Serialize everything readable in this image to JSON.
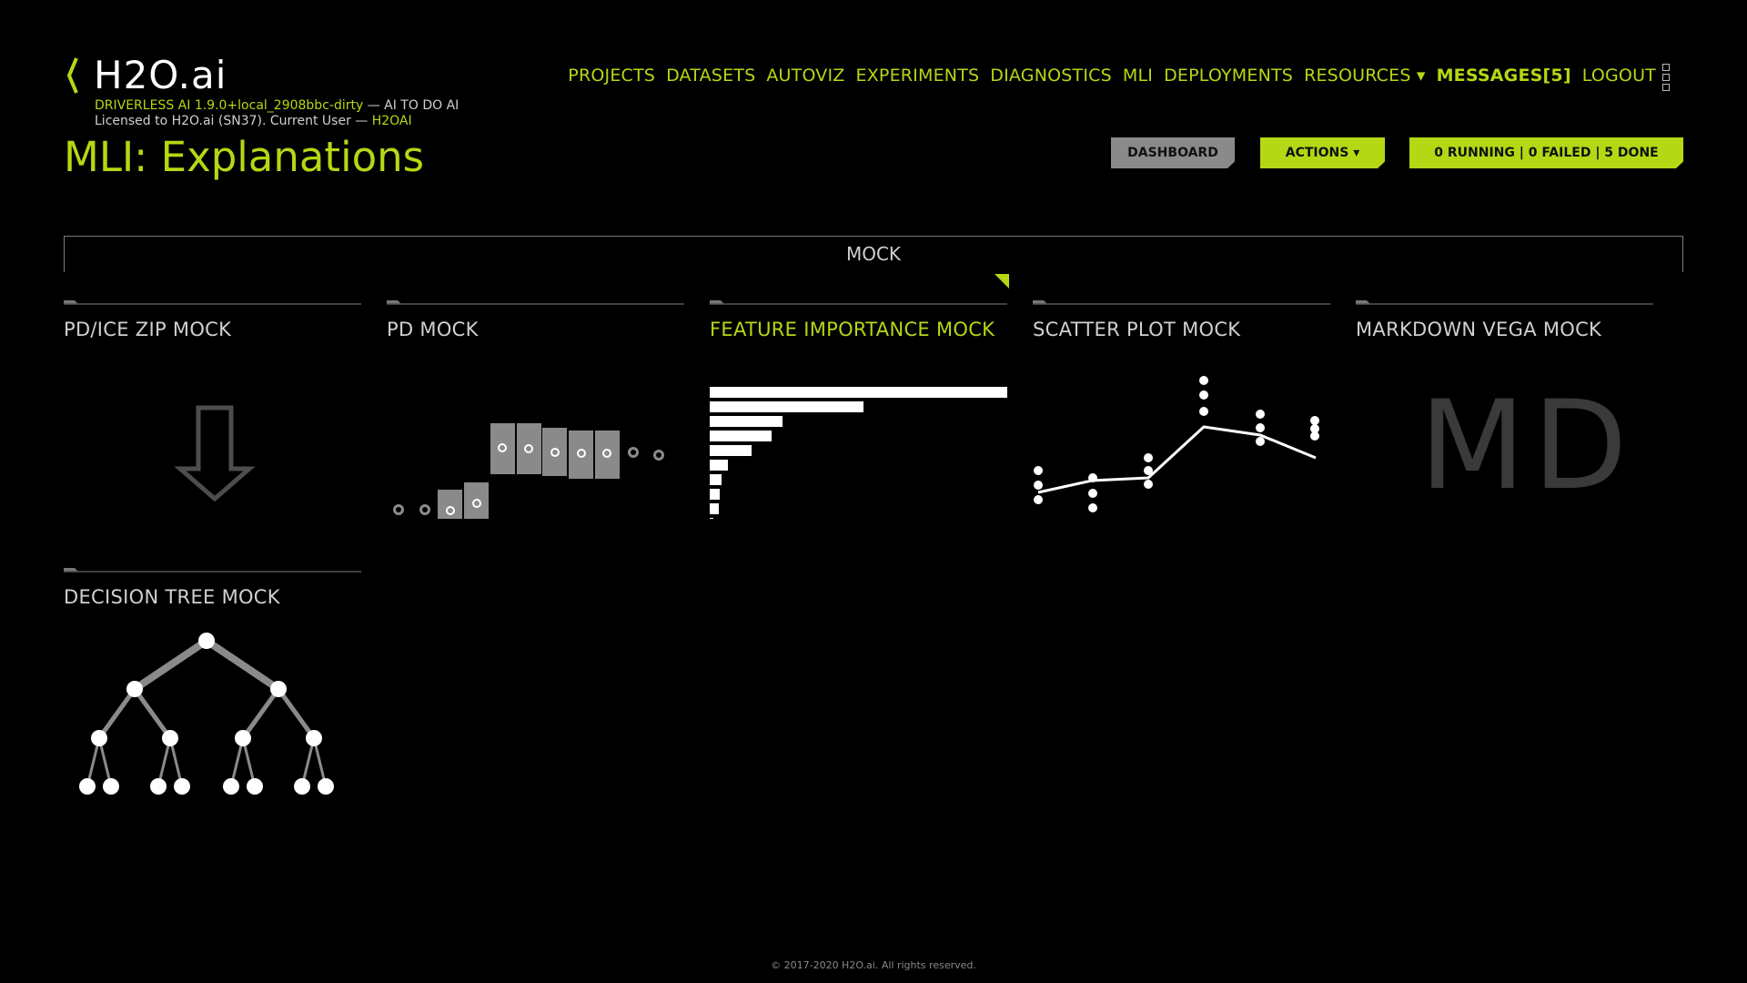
{
  "brand": {
    "logo_text": "H2O.ai"
  },
  "version": {
    "product": "DRIVERLESS AI 1.9.0+local_2908bbc-dirty",
    "tagline": " — AI TO DO AI",
    "license": "Licensed to H2O.ai (SN37). Current User — ",
    "user": "H2OAI"
  },
  "page_title": "MLI: Explanations",
  "nav": {
    "projects": "PROJECTS",
    "datasets": "DATASETS",
    "autoviz": "AUTOVIZ",
    "experiments": "EXPERIMENTS",
    "diagnostics": "DIAGNOSTICS",
    "mli": "MLI",
    "deployments": "DEPLOYMENTS",
    "resources": "RESOURCES ▾",
    "messages": "MESSAGES[5]",
    "logout": "LOGOUT"
  },
  "buttons": {
    "dashboard": "DASHBOARD",
    "actions": "ACTIONS ▾",
    "status": "0 RUNNING | 0 FAILED | 5 DONE"
  },
  "mock_tab": "MOCK",
  "cards": {
    "pd_ice_zip": "PD/ICE ZIP MOCK",
    "pd": "PD MOCK",
    "feature_importance": "FEATURE IMPORTANCE MOCK",
    "scatter": "SCATTER PLOT MOCK",
    "markdown_vega": "MARKDOWN VEGA MOCK",
    "decision_tree": "DECISION TREE MOCK"
  },
  "md_glyph": "MD",
  "footer": "© 2017-2020 H2O.ai. All rights reserved.",
  "colors": {
    "accent": "#b4d814",
    "muted": "#8a8a8a",
    "background": "#000000"
  },
  "icons": {
    "logo": "bracket-logo-icon",
    "menu": "grid-menu-icon",
    "download": "download-arrow-icon"
  }
}
